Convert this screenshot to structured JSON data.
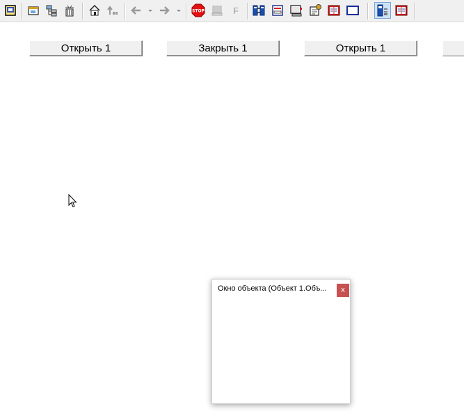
{
  "buttons": [
    {
      "label": "Открыть 1"
    },
    {
      "label": "Закрыть 1"
    },
    {
      "label": "Открыть 1"
    },
    {
      "label": ""
    }
  ],
  "object_window": {
    "title": "Окно объекта (Объект 1.Объ...",
    "close_label": "x"
  },
  "toolbar": {
    "icons": [
      "properties-icon",
      "window-icon",
      "tree-icon",
      "trash-icon",
      "home-icon",
      "up-level-icon",
      "back-arrow-icon",
      "forward-arrow-icon",
      "stop-icon",
      "computer-icon",
      "f-icon",
      "objects-icon",
      "form-icon",
      "monitor-icon",
      "settings-icon",
      "book-icon",
      "frame-icon",
      "config-icon",
      "book-mode-icon"
    ],
    "stop_text": "STOP",
    "f_text": "F"
  },
  "colors": {
    "accent": "#c75050",
    "toolbar_bg": "#f0f0f0"
  }
}
